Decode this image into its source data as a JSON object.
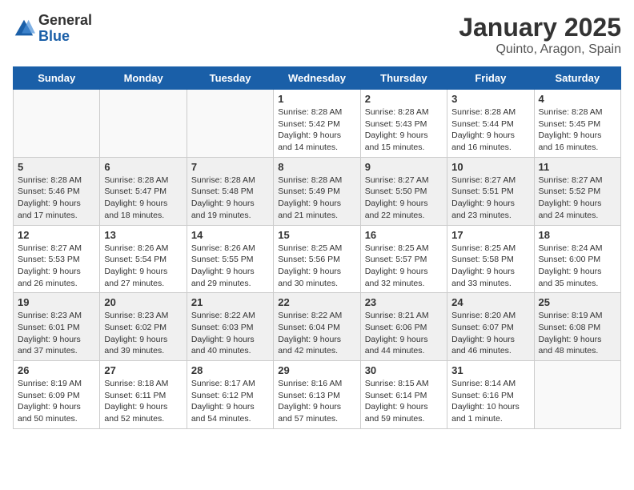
{
  "logo": {
    "general": "General",
    "blue": "Blue"
  },
  "title": "January 2025",
  "location": "Quinto, Aragon, Spain",
  "weekdays": [
    "Sunday",
    "Monday",
    "Tuesday",
    "Wednesday",
    "Thursday",
    "Friday",
    "Saturday"
  ],
  "weeks": [
    [
      {
        "day": "",
        "content": ""
      },
      {
        "day": "",
        "content": ""
      },
      {
        "day": "",
        "content": ""
      },
      {
        "day": "1",
        "content": "Sunrise: 8:28 AM\nSunset: 5:42 PM\nDaylight: 9 hours\nand 14 minutes."
      },
      {
        "day": "2",
        "content": "Sunrise: 8:28 AM\nSunset: 5:43 PM\nDaylight: 9 hours\nand 15 minutes."
      },
      {
        "day": "3",
        "content": "Sunrise: 8:28 AM\nSunset: 5:44 PM\nDaylight: 9 hours\nand 16 minutes."
      },
      {
        "day": "4",
        "content": "Sunrise: 8:28 AM\nSunset: 5:45 PM\nDaylight: 9 hours\nand 16 minutes."
      }
    ],
    [
      {
        "day": "5",
        "content": "Sunrise: 8:28 AM\nSunset: 5:46 PM\nDaylight: 9 hours\nand 17 minutes."
      },
      {
        "day": "6",
        "content": "Sunrise: 8:28 AM\nSunset: 5:47 PM\nDaylight: 9 hours\nand 18 minutes."
      },
      {
        "day": "7",
        "content": "Sunrise: 8:28 AM\nSunset: 5:48 PM\nDaylight: 9 hours\nand 19 minutes."
      },
      {
        "day": "8",
        "content": "Sunrise: 8:28 AM\nSunset: 5:49 PM\nDaylight: 9 hours\nand 21 minutes."
      },
      {
        "day": "9",
        "content": "Sunrise: 8:27 AM\nSunset: 5:50 PM\nDaylight: 9 hours\nand 22 minutes."
      },
      {
        "day": "10",
        "content": "Sunrise: 8:27 AM\nSunset: 5:51 PM\nDaylight: 9 hours\nand 23 minutes."
      },
      {
        "day": "11",
        "content": "Sunrise: 8:27 AM\nSunset: 5:52 PM\nDaylight: 9 hours\nand 24 minutes."
      }
    ],
    [
      {
        "day": "12",
        "content": "Sunrise: 8:27 AM\nSunset: 5:53 PM\nDaylight: 9 hours\nand 26 minutes."
      },
      {
        "day": "13",
        "content": "Sunrise: 8:26 AM\nSunset: 5:54 PM\nDaylight: 9 hours\nand 27 minutes."
      },
      {
        "day": "14",
        "content": "Sunrise: 8:26 AM\nSunset: 5:55 PM\nDaylight: 9 hours\nand 29 minutes."
      },
      {
        "day": "15",
        "content": "Sunrise: 8:25 AM\nSunset: 5:56 PM\nDaylight: 9 hours\nand 30 minutes."
      },
      {
        "day": "16",
        "content": "Sunrise: 8:25 AM\nSunset: 5:57 PM\nDaylight: 9 hours\nand 32 minutes."
      },
      {
        "day": "17",
        "content": "Sunrise: 8:25 AM\nSunset: 5:58 PM\nDaylight: 9 hours\nand 33 minutes."
      },
      {
        "day": "18",
        "content": "Sunrise: 8:24 AM\nSunset: 6:00 PM\nDaylight: 9 hours\nand 35 minutes."
      }
    ],
    [
      {
        "day": "19",
        "content": "Sunrise: 8:23 AM\nSunset: 6:01 PM\nDaylight: 9 hours\nand 37 minutes."
      },
      {
        "day": "20",
        "content": "Sunrise: 8:23 AM\nSunset: 6:02 PM\nDaylight: 9 hours\nand 39 minutes."
      },
      {
        "day": "21",
        "content": "Sunrise: 8:22 AM\nSunset: 6:03 PM\nDaylight: 9 hours\nand 40 minutes."
      },
      {
        "day": "22",
        "content": "Sunrise: 8:22 AM\nSunset: 6:04 PM\nDaylight: 9 hours\nand 42 minutes."
      },
      {
        "day": "23",
        "content": "Sunrise: 8:21 AM\nSunset: 6:06 PM\nDaylight: 9 hours\nand 44 minutes."
      },
      {
        "day": "24",
        "content": "Sunrise: 8:20 AM\nSunset: 6:07 PM\nDaylight: 9 hours\nand 46 minutes."
      },
      {
        "day": "25",
        "content": "Sunrise: 8:19 AM\nSunset: 6:08 PM\nDaylight: 9 hours\nand 48 minutes."
      }
    ],
    [
      {
        "day": "26",
        "content": "Sunrise: 8:19 AM\nSunset: 6:09 PM\nDaylight: 9 hours\nand 50 minutes."
      },
      {
        "day": "27",
        "content": "Sunrise: 8:18 AM\nSunset: 6:11 PM\nDaylight: 9 hours\nand 52 minutes."
      },
      {
        "day": "28",
        "content": "Sunrise: 8:17 AM\nSunset: 6:12 PM\nDaylight: 9 hours\nand 54 minutes."
      },
      {
        "day": "29",
        "content": "Sunrise: 8:16 AM\nSunset: 6:13 PM\nDaylight: 9 hours\nand 57 minutes."
      },
      {
        "day": "30",
        "content": "Sunrise: 8:15 AM\nSunset: 6:14 PM\nDaylight: 9 hours\nand 59 minutes."
      },
      {
        "day": "31",
        "content": "Sunrise: 8:14 AM\nSunset: 6:16 PM\nDaylight: 10 hours\nand 1 minute."
      },
      {
        "day": "",
        "content": ""
      }
    ]
  ]
}
